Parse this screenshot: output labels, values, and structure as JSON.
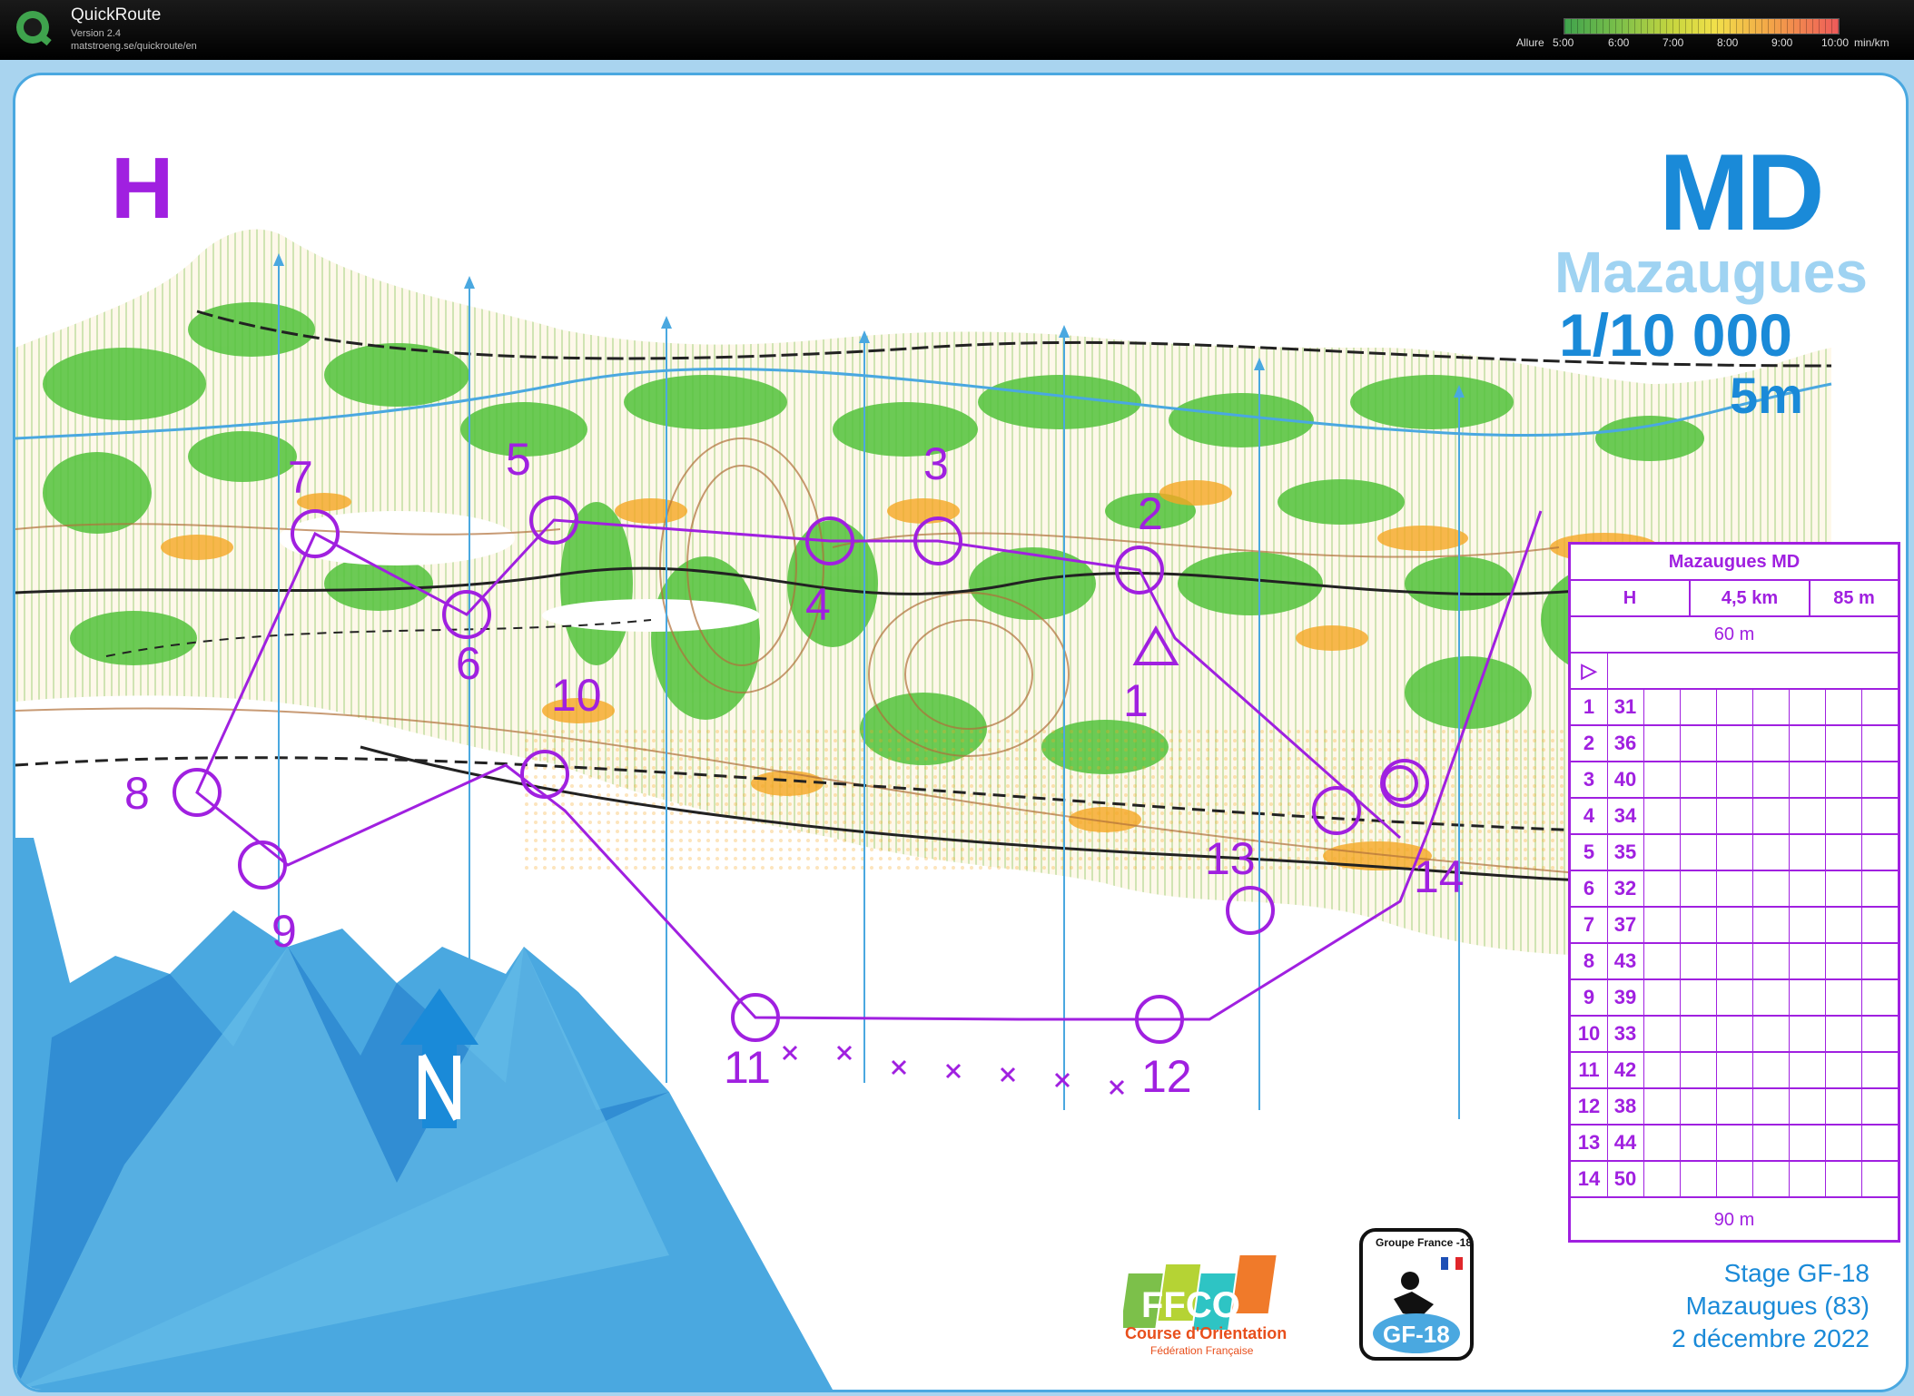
{
  "app": {
    "title": "QuickRoute",
    "version": "Version 2.4",
    "url": "matstroeng.se/quickroute/en"
  },
  "pace_legend": {
    "label": "Allure",
    "ticks": [
      "5:00",
      "6:00",
      "7:00",
      "8:00",
      "9:00",
      "10:00"
    ],
    "unit": "min/km",
    "range_min_per_km": [
      5,
      10
    ]
  },
  "map": {
    "class": "H",
    "race_type": "MD",
    "name": "Mazaugues",
    "scale": "1/10 000",
    "equidistance": "5m",
    "colors": {
      "course": "#a020e0",
      "title": "#1a8ad8",
      "water": "#4aa8e0"
    },
    "controls": [
      "1",
      "2",
      "3",
      "4",
      "5",
      "6",
      "7",
      "8",
      "9",
      "10",
      "11",
      "12",
      "13",
      "14"
    ],
    "north_icon": "north-arrow-icon"
  },
  "control_descriptions": {
    "event": "Mazaugues MD",
    "class": "H",
    "length": "4,5 km",
    "climb": "85 m",
    "start_marking": "60 m",
    "finish_marking": "90 m",
    "rows": [
      {
        "num": "1",
        "code": "31"
      },
      {
        "num": "2",
        "code": "36"
      },
      {
        "num": "3",
        "code": "40"
      },
      {
        "num": "4",
        "code": "34"
      },
      {
        "num": "5",
        "code": "35"
      },
      {
        "num": "6",
        "code": "32"
      },
      {
        "num": "7",
        "code": "37"
      },
      {
        "num": "8",
        "code": "43"
      },
      {
        "num": "9",
        "code": "39"
      },
      {
        "num": "10",
        "code": "33"
      },
      {
        "num": "11",
        "code": "42"
      },
      {
        "num": "12",
        "code": "38"
      },
      {
        "num": "13",
        "code": "44"
      },
      {
        "num": "14",
        "code": "50"
      }
    ]
  },
  "stage": {
    "line1": "Stage GF-18",
    "line2": "Mazaugues (83)",
    "line3": "2 décembre 2022"
  },
  "logos": {
    "ffco": "FFCO",
    "ffco_caption": "Course d'Orientation",
    "ffco_sub": "Fédération Française",
    "gf18_top": "Groupe France -18",
    "gf18": "GF-18"
  }
}
